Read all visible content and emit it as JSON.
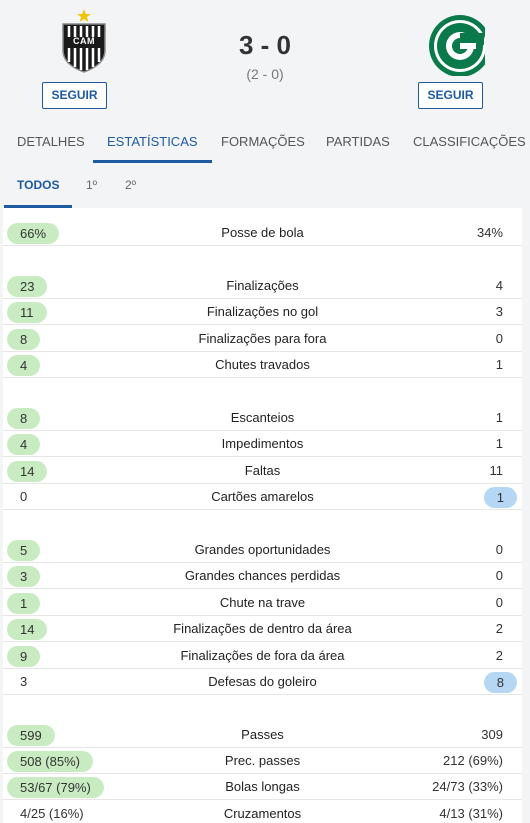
{
  "match": {
    "home": {
      "name": "CAM",
      "follow_label": "SEGUIR"
    },
    "away": {
      "name": "Goiás",
      "follow_label": "SEGUIR"
    },
    "score": "3 - 0",
    "halftime": "(2 - 0)"
  },
  "tabs": [
    {
      "label": "DETALHES",
      "active": false
    },
    {
      "label": "ESTATÍSTICAS",
      "active": true
    },
    {
      "label": "FORMAÇÕES",
      "active": false
    },
    {
      "label": "PARTIDAS",
      "active": false
    },
    {
      "label": "CLASSIFICAÇÕES",
      "active": false
    }
  ],
  "subtabs": [
    {
      "label": "TODOS",
      "active": true
    },
    {
      "label": "1º",
      "active": false
    },
    {
      "label": "2º",
      "active": false
    }
  ],
  "colors": {
    "accent": "#1d5aa0",
    "home_highlight": "#c9ebc2",
    "away_highlight": "#b5d7f4"
  },
  "stats": [
    {
      "label": "Posse de bola",
      "home": "66%",
      "away": "34%",
      "leader": "home"
    },
    {
      "label": "Finalizações",
      "home": "23",
      "away": "4",
      "leader": "home"
    },
    {
      "label": "Finalizações no gol",
      "home": "11",
      "away": "3",
      "leader": "home"
    },
    {
      "label": "Finalizações para fora",
      "home": "8",
      "away": "0",
      "leader": "home"
    },
    {
      "label": "Chutes travados",
      "home": "4",
      "away": "1",
      "leader": "home"
    },
    {
      "label": "Escanteios",
      "home": "8",
      "away": "1",
      "leader": "home"
    },
    {
      "label": "Impedimentos",
      "home": "4",
      "away": "1",
      "leader": "home"
    },
    {
      "label": "Faltas",
      "home": "14",
      "away": "11",
      "leader": "home"
    },
    {
      "label": "Cartões amarelos",
      "home": "0",
      "away": "1",
      "leader": "away"
    },
    {
      "label": "Grandes oportunidades",
      "home": "5",
      "away": "0",
      "leader": "home"
    },
    {
      "label": "Grandes chances perdidas",
      "home": "3",
      "away": "0",
      "leader": "home"
    },
    {
      "label": "Chute na trave",
      "home": "1",
      "away": "0",
      "leader": "home"
    },
    {
      "label": "Finalizações de dentro da área",
      "home": "14",
      "away": "2",
      "leader": "home"
    },
    {
      "label": "Finalizações de fora da área",
      "home": "9",
      "away": "2",
      "leader": "home"
    },
    {
      "label": "Defesas do goleiro",
      "home": "3",
      "away": "8",
      "leader": "away"
    },
    {
      "label": "Passes",
      "home": "599",
      "away": "309",
      "leader": "home"
    },
    {
      "label": "Prec. passes",
      "home": "508 (85%)",
      "away": "212 (69%)",
      "leader": "home"
    },
    {
      "label": "Bolas longas",
      "home": "53/67 (79%)",
      "away": "24/73 (33%)",
      "leader": "home"
    },
    {
      "label": "Cruzamentos",
      "home": "4/25 (16%)",
      "away": "4/13 (31%)",
      "leader": "none"
    }
  ]
}
